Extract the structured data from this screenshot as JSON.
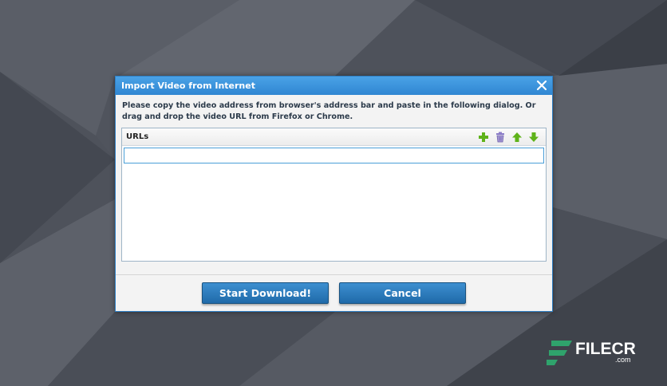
{
  "dialog": {
    "title": "Import Video from Internet",
    "close_icon": "close-icon",
    "instructions": "Please copy the video address from browser's address bar and paste in the following dialog. Or drag and drop the video URL from Firefox or Chrome.",
    "urls": {
      "header_label": "URLs",
      "toolbar": {
        "add_icon": "plus-icon",
        "delete_icon": "trash-icon",
        "move_up_icon": "arrow-up-icon",
        "move_down_icon": "arrow-down-icon"
      },
      "input_value": "",
      "items": []
    },
    "buttons": {
      "start_label": "Start Download!",
      "cancel_label": "Cancel"
    }
  },
  "watermark": {
    "brand": "FILECR",
    "suffix": ".com"
  },
  "colors": {
    "titlebar": "#2f86d2",
    "button": "#2a78bd",
    "tool_green": "#6dbd1f",
    "tool_trash": "#8b7dc9",
    "desktop": "#4f535c",
    "logo_green": "#2fa36c"
  }
}
